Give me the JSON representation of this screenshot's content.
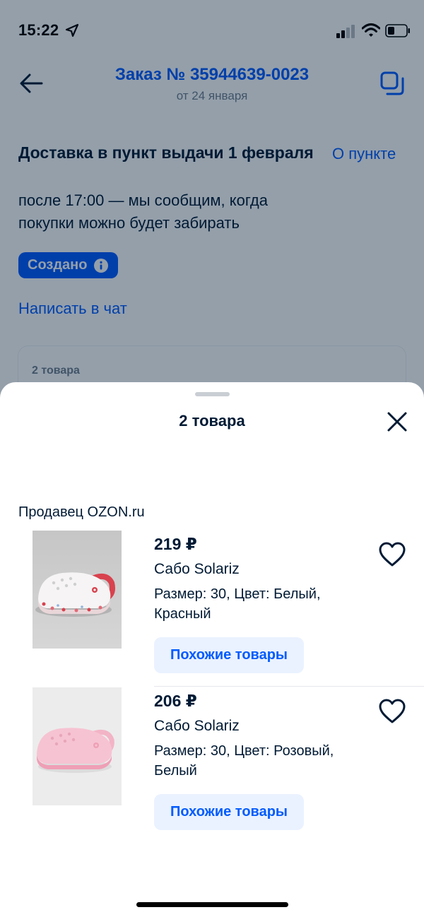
{
  "status_bar": {
    "time": "15:22"
  },
  "header": {
    "title": "Заказ № 35944639-0023",
    "subtitle": "от 24 января"
  },
  "delivery": {
    "title": "Доставка в пункт выдачи 1 февраля",
    "point_link": "О пункте",
    "note": "после 17:00 — мы сообщим, когда покупки можно будет забирать"
  },
  "status_badge": "Создано",
  "chat_link": "Написать в чат",
  "items_card": {
    "label": "2 товара"
  },
  "sheet": {
    "title": "2 товара",
    "seller": "Продавец OZON.ru",
    "products": [
      {
        "price": "219 ₽",
        "name": "Сабо Solariz",
        "attrs": "Размер: 30, Цвет: Белый, Красный",
        "button": "Похожие товары"
      },
      {
        "price": "206 ₽",
        "name": "Сабо Solariz",
        "attrs": "Размер: 30, Цвет: Розовый, Белый",
        "button": "Похожие товары"
      }
    ]
  },
  "colors": {
    "accent": "#005bff",
    "text": "#001a34",
    "button_bg": "#eaf2ff",
    "muted": "#707f8d"
  }
}
